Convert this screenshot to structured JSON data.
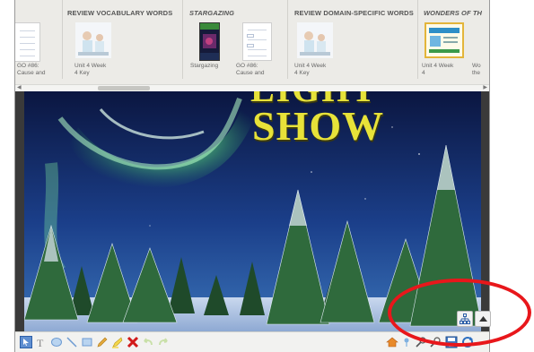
{
  "strip": {
    "sections": [
      {
        "title": "REVIEW VOCABULARY WORDS",
        "italic": false
      },
      {
        "title": "STARGAZING",
        "italic": true
      },
      {
        "title": "REVIEW DOMAIN-SPECIFIC WORDS",
        "italic": false
      },
      {
        "title": "WONDERS OF TH",
        "italic": true
      }
    ],
    "captions": {
      "c0": "GO #86:",
      "c0b": "Cause and",
      "c1": "Unit 4 Week",
      "c1b": "4 Key",
      "c2": "Stargazing",
      "c3": "GO #86:",
      "c3b": "Cause and",
      "c4": "Unit 4 Week",
      "c4b": "4 Key",
      "c5": "Unit 4 Week",
      "c5b": "4",
      "c6": "Wo",
      "c6b": "the"
    }
  },
  "slide": {
    "title_line1": "LIGHT",
    "title_line2": "SHOW"
  },
  "toolbar": {
    "tools": [
      "pointer-tool-icon",
      "text-tool-icon",
      "ellipse-tool-icon",
      "line-tool-icon",
      "rectangle-tool-icon",
      "pen-tool-icon",
      "highlighter-tool-icon",
      "delete-icon",
      "undo-icon",
      "redo-icon"
    ],
    "right_tools": [
      "home-icon",
      "pin-icon",
      "zoom-in-icon",
      "zoom-out-icon",
      "save-icon",
      "refresh-icon"
    ]
  },
  "colors": {
    "annotation": "#e8171b",
    "title_yellow": "#e7e239",
    "sky_top": "#0b1a4a",
    "aurora": "#8cff9a"
  }
}
